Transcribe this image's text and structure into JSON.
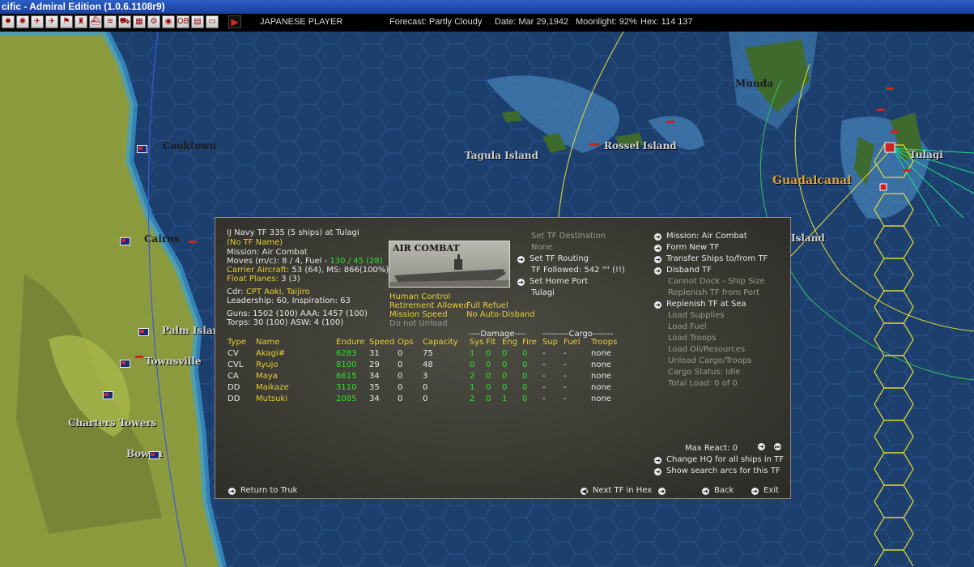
{
  "window": {
    "title": "cific - Admiral Edition (1.0.6.1108r9)"
  },
  "toolbar": {
    "player": "JAPANESE PLAYER",
    "forecast": "Forecast: Partly Cloudy",
    "date": "Date: Mar 29,1942",
    "moonlight": "Moonlight: 92%",
    "hex": "Hex: 114 137"
  },
  "map": {
    "labels": [
      "Cooktown",
      "Cairns",
      "Palm Islan",
      "Townsville",
      "Charters Towers",
      "Bowen",
      "Tagula Island",
      "Rossel Island",
      "Munda",
      "Guadalcanal",
      "Tulagi",
      "Island"
    ]
  },
  "tf": {
    "header": "IJ Navy TF 335 (5 ships) at Tulagi",
    "name": "(No TF Name)",
    "mission": "Mission: Air Combat",
    "moves_prefix": "Moves (m/c): 8 / 4, Fuel - ",
    "fuel_values": "130 / 45 (28)",
    "carrier_aircraft_label": "Carrier Aircraft:",
    "carrier_aircraft_value": " 53 (64), MS: 866(100%)",
    "float_planes_label": "Float Planes:",
    "float_planes_value": " 3 (3)",
    "cdr_label": "Cdr:",
    "cdr_value": "CPT  Aoki, Taijiro",
    "leadership": "Leadership: 60, Inspiration: 63",
    "guns": "Guns: 1502 (100)  AAA: 1457 (100)",
    "torps": "Torps: 30 (100)      ASW: 4 (100)",
    "photo_caption": "AIR COMBAT",
    "human_control": "Human Control",
    "retirement": "Retirement Allowed",
    "full_refuel": "Full Refuel",
    "mission_speed": "Mission Speed",
    "no_auto_disband": "No Auto-Disband",
    "do_not_unload": "Do not Unload",
    "set_destination": "Set TF Destination",
    "destination_value": "None",
    "set_routing": "Set TF Routing",
    "followed": "TF Followed: 542 \"\" (!!)",
    "set_home_port": "Set Home Port",
    "home_port_value": "Tulagi"
  },
  "actions": [
    {
      "label": "Mission: Air Combat",
      "enabled": true,
      "arrow": true
    },
    {
      "label": "Form New TF",
      "enabled": true,
      "arrow": true
    },
    {
      "label": "Transfer Ships to/from TF",
      "enabled": true,
      "arrow": true
    },
    {
      "label": "Disband TF",
      "enabled": true,
      "arrow": true
    },
    {
      "label": "Cannot Dock - Ship Size",
      "enabled": false,
      "arrow": false
    },
    {
      "label": "Replenish TF from Port",
      "enabled": false,
      "arrow": false
    },
    {
      "label": "Replenish TF at Sea",
      "enabled": true,
      "arrow": true
    },
    {
      "label": "Load Supplies",
      "enabled": false,
      "arrow": false
    },
    {
      "label": "Load Fuel",
      "enabled": false,
      "arrow": false
    },
    {
      "label": "Load Troops",
      "enabled": false,
      "arrow": false
    },
    {
      "label": "Load Oil/Resources",
      "enabled": false,
      "arrow": false
    },
    {
      "label": "Unload Cargo/Troops",
      "enabled": false,
      "arrow": false
    },
    {
      "label": "Cargo Status: Idle",
      "enabled": false,
      "arrow": false
    },
    {
      "label": "Total Load: 0 of 0",
      "enabled": false,
      "arrow": false
    }
  ],
  "table": {
    "damage_header": "----Damage----",
    "cargo_header": "---------Cargo-------",
    "columns": [
      "Type",
      "Name",
      "Endure",
      "Speed",
      "Ops",
      "Capacity",
      "Sys",
      "Flt",
      "Eng",
      "Fire",
      "Sup",
      "Fuel",
      "Troops"
    ],
    "rows": [
      {
        "type": "CV",
        "name": "Akagi#",
        "endure": "6283",
        "speed": "31",
        "ops": "0",
        "capacity": "75",
        "sys": "1",
        "flt": "0",
        "eng": "0",
        "fire": "0",
        "sup": "-",
        "fuel": "-",
        "troops": "none"
      },
      {
        "type": "CVL",
        "name": "Ryujo",
        "endure": "8100",
        "speed": "29",
        "ops": "0",
        "capacity": "48",
        "sys": "0",
        "flt": "0",
        "eng": "0",
        "fire": "0",
        "sup": "-",
        "fuel": "-",
        "troops": "none"
      },
      {
        "type": "CA",
        "name": "Maya",
        "endure": "6615",
        "speed": "34",
        "ops": "0",
        "capacity": "3",
        "sys": "2",
        "flt": "0",
        "eng": "0",
        "fire": "0",
        "sup": "-",
        "fuel": "-",
        "troops": "none"
      },
      {
        "type": "DD",
        "name": "Maikaze",
        "endure": "3110",
        "speed": "35",
        "ops": "0",
        "capacity": "0",
        "sys": "1",
        "flt": "0",
        "eng": "0",
        "fire": "0",
        "sup": "-",
        "fuel": "-",
        "troops": "none"
      },
      {
        "type": "DD",
        "name": "Mutsuki",
        "endure": "2085",
        "speed": "34",
        "ops": "0",
        "capacity": "0",
        "sys": "2",
        "flt": "0",
        "eng": "1",
        "fire": "0",
        "sup": "-",
        "fuel": "-",
        "troops": "none"
      }
    ]
  },
  "bottom": {
    "max_react": "Max React:  0",
    "change_hq": "Change HQ for all ships in TF",
    "show_arcs": "Show search arcs for this TF",
    "return": "Return to Truk",
    "next_tf": "Next TF in Hex",
    "back": "Back",
    "exit": "Exit"
  }
}
